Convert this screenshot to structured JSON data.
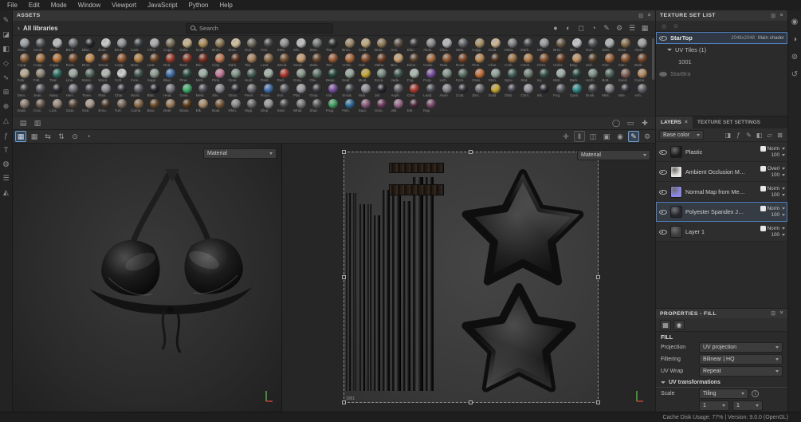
{
  "chrome": {
    "dock": "⊡",
    "close": "×"
  },
  "menubar": {
    "items": [
      "File",
      "Edit",
      "Mode",
      "Window",
      "Viewport",
      "JavaScript",
      "Python",
      "Help"
    ]
  },
  "tools": [
    {
      "name": "paint-tool-icon",
      "g": "✎"
    },
    {
      "name": "eraser-tool-icon",
      "g": "◪"
    },
    {
      "name": "projection-tool-icon",
      "g": "◧"
    },
    {
      "name": "polygon-fill-tool-icon",
      "g": "◇"
    },
    {
      "name": "smudge-tool-icon",
      "g": "∿"
    },
    {
      "name": "clone-tool-icon",
      "g": "⊞"
    },
    {
      "name": "material-picker-tool-icon",
      "g": "⊕"
    },
    {
      "name": "geometry-mask-tool-icon",
      "g": "△"
    },
    {
      "name": "effects-tool-icon",
      "g": "ƒ"
    },
    {
      "name": "text-tool-icon",
      "g": "T"
    },
    {
      "name": "particles-tool-icon",
      "g": "◍"
    },
    {
      "name": "shelf-tool-icon",
      "g": "☰"
    },
    {
      "name": "symmetry-tool-icon",
      "g": "◭"
    }
  ],
  "assets": {
    "panel_title": "ASSETS",
    "breadcrumb": "All libraries",
    "search_placeholder": "Search",
    "filter_icons": [
      {
        "name": "filter-materials-icon",
        "g": "●"
      },
      {
        "name": "filter-smart-materials-icon",
        "g": "◐"
      },
      {
        "name": "filter-smart-masks-icon",
        "g": "◻"
      },
      {
        "name": "filter-filters-icon",
        "g": "◔"
      },
      {
        "name": "filter-brushes-icon",
        "g": "✎"
      },
      {
        "name": "filter-settings-icon",
        "g": "⚙"
      },
      {
        "name": "list-view-icon",
        "g": "☰"
      },
      {
        "name": "grid-view-icon",
        "g": "▦"
      }
    ],
    "footer_left_icons": [
      {
        "name": "shelf-panel-icon",
        "g": "▤"
      },
      {
        "name": "import-resources-icon",
        "g": "▥"
      }
    ],
    "footer_right_icons": [
      {
        "name": "sphere-preview-icon",
        "g": "◯"
      },
      {
        "name": "plane-preview-icon",
        "g": "▭"
      },
      {
        "name": "add-resource-icon",
        "g": "✚"
      }
    ],
    "materials": [
      [
        "#9aa0a6",
        "Alum."
      ],
      [
        "#585b5e",
        "Anod."
      ],
      [
        "#b9bcc0",
        "Alum."
      ],
      [
        "#6f7377",
        "Bent."
      ],
      [
        "#26282a",
        "Blac."
      ],
      [
        "#caccce",
        "Bras."
      ],
      [
        "#8e9296",
        "Brus."
      ],
      [
        "#3f4346",
        "Cast."
      ],
      [
        "#a7a9ac",
        "Chro."
      ],
      [
        "#7c6f5a",
        "Copp."
      ],
      [
        "#c8b288",
        "Gold."
      ],
      [
        "#b08d57",
        "Gold."
      ],
      [
        "#8c7853",
        "Bron."
      ],
      [
        "#d4c29a",
        "Bras."
      ],
      [
        "#6e6a5e",
        "Gun."
      ],
      [
        "#4a4a4a",
        "Iron."
      ],
      [
        "#909090",
        "Stee."
      ],
      [
        "#bfc1c3",
        "Silv."
      ],
      [
        "#757779",
        "Stee."
      ],
      [
        "#2f3133",
        "Tita."
      ],
      [
        "#a08968",
        "Bron."
      ],
      [
        "#c0a878",
        "Gold."
      ],
      [
        "#927c58",
        "Bras."
      ],
      [
        "#5c5347",
        "Iron."
      ],
      [
        "#3a3a3c",
        "Blac."
      ],
      [
        "#888a8c",
        "Alum."
      ],
      [
        "#b5b7b9",
        "Chro."
      ],
      [
        "#63666a",
        "Stee."
      ],
      [
        "#ad9166",
        "Copp."
      ],
      [
        "#cdb68e",
        "Gold."
      ],
      [
        "#7e8184",
        "Meta."
      ],
      [
        "#46494c",
        "Dark."
      ],
      [
        "#979a9d",
        "Silv."
      ],
      [
        "#6b5d45",
        "Brnz."
      ],
      [
        "#c4c6c8",
        "Mirr."
      ],
      [
        "#53565a",
        "Gun."
      ],
      [
        "#aeb0b2",
        "Stee."
      ],
      [
        "#8a6f4d",
        "Bras."
      ],
      [
        "#9c9ea0",
        "Alum."
      ],
      [
        "#8a5a33",
        "Copp."
      ],
      [
        "#a9713f",
        "Copp."
      ],
      [
        "#b87333",
        "Copp."
      ],
      [
        "#7a4a28",
        "Rust."
      ],
      [
        "#c98a4b",
        "Bron."
      ],
      [
        "#5f3a22",
        "Wood."
      ],
      [
        "#96572e",
        "Copp."
      ],
      [
        "#b5803f",
        "Bras."
      ],
      [
        "#6d4326",
        "Leat."
      ],
      [
        "#a33c2e",
        "Red."
      ],
      [
        "#8f3a2a",
        "Rust."
      ],
      [
        "#7e2f24",
        "Bric."
      ],
      [
        "#c47a52",
        "Clay."
      ],
      [
        "#5a3020",
        "Dark."
      ],
      [
        "#a9845d",
        "Tan."
      ],
      [
        "#8b6a46",
        "Leat."
      ],
      [
        "#744f30",
        "Wood."
      ],
      [
        "#c79a6b",
        "Sand."
      ],
      [
        "#63452c",
        "Waln."
      ],
      [
        "#9d5c35",
        "Terr."
      ],
      [
        "#b06a3a",
        "Ambr."
      ],
      [
        "#854d2a",
        "Oak."
      ],
      [
        "#6f3d23",
        "Maho."
      ],
      [
        "#caa06e",
        "Birc."
      ],
      [
        "#58422c",
        "Ebon."
      ],
      [
        "#a76b3e",
        "Ceda."
      ],
      [
        "#905832",
        "Teak."
      ],
      [
        "#7c4626",
        "Rose."
      ],
      [
        "#bd8a55",
        "Pine."
      ],
      [
        "#4f3521",
        "Char."
      ],
      [
        "#9e7142",
        "Cork."
      ],
      [
        "#b27c45",
        "Hone."
      ],
      [
        "#87552f",
        "Ches."
      ],
      [
        "#6a3e24",
        "Umbr."
      ],
      [
        "#c09363",
        "Beig."
      ],
      [
        "#564028",
        "Soil."
      ],
      [
        "#a2653a",
        "Ginr."
      ],
      [
        "#8e5630",
        "Sien."
      ],
      [
        "#78482a",
        "Bark."
      ],
      [
        "#b8a88e",
        "Fabr."
      ],
      [
        "#8e8474",
        "Felt."
      ],
      [
        "#2e6e62",
        "Teal."
      ],
      [
        "#9aa89e",
        "Line."
      ],
      [
        "#556b60",
        "Moss."
      ],
      [
        "#b0b8ae",
        "Wool."
      ],
      [
        "#cfd2cf",
        "Cott."
      ],
      [
        "#41584e",
        "Fore."
      ],
      [
        "#8a9a8e",
        "Sage."
      ],
      [
        "#3f6fae",
        "Blue."
      ],
      [
        "#2f4f45",
        "Pine."
      ],
      [
        "#9eb0a4",
        "Mint."
      ],
      [
        "#c87a9a",
        "Pink."
      ],
      [
        "#7e9486",
        "Gree."
      ],
      [
        "#486056",
        "Hunt."
      ],
      [
        "#a4b4a8",
        "Past."
      ],
      [
        "#b03a2e",
        "Red."
      ],
      [
        "#88988c",
        "Gray."
      ],
      [
        "#60746a",
        "Oliv."
      ],
      [
        "#294a40",
        "Deep."
      ],
      [
        "#96a89c",
        "Seaf."
      ],
      [
        "#c8a832",
        "Must."
      ],
      [
        "#788c80",
        "Euca."
      ],
      [
        "#3e5a50",
        "Jade."
      ],
      [
        "#aab8ae",
        "Fog."
      ],
      [
        "#7a4fa0",
        "Purp."
      ],
      [
        "#82968a",
        "Lich."
      ],
      [
        "#5a7066",
        "Fern."
      ],
      [
        "#c87137",
        "Oran."
      ],
      [
        "#90a296",
        "Ston."
      ],
      [
        "#46625a",
        "Spru."
      ],
      [
        "#748478",
        "Slat."
      ],
      [
        "#38564c",
        "Ivy."
      ],
      [
        "#a0b0a6",
        "Mist."
      ],
      [
        "#2a4a42",
        "Dark."
      ],
      [
        "#7c9084",
        "Herb."
      ],
      [
        "#52685e",
        "Bott."
      ],
      [
        "#86655a",
        "Sued."
      ],
      [
        "#b5895f",
        "Came."
      ],
      [
        "#3b3b3d",
        "Deni."
      ],
      [
        "#54565c",
        "Jean."
      ],
      [
        "#2b2d33",
        "Navy."
      ],
      [
        "#6e7076",
        "Herr."
      ],
      [
        "#44464c",
        "Twee."
      ],
      [
        "#8a8c92",
        "Flan."
      ],
      [
        "#33353b",
        "Char."
      ],
      [
        "#5c5e64",
        "Wors."
      ],
      [
        "#24262c",
        "Blac."
      ],
      [
        "#76787e",
        "Heat."
      ],
      [
        "#3fae6a",
        "Gree."
      ],
      [
        "#4c4e54",
        "Mela."
      ],
      [
        "#86888e",
        "Silv."
      ],
      [
        "#2e3036",
        "Onyx."
      ],
      [
        "#66686e",
        "Pewt."
      ],
      [
        "#3f6fae",
        "Roya."
      ],
      [
        "#585a60",
        "Iron."
      ],
      [
        "#9b9da3",
        "Plat."
      ],
      [
        "#3a3c42",
        "Grap."
      ],
      [
        "#7a4fa0",
        "Viol."
      ],
      [
        "#44464c",
        "Smok."
      ],
      [
        "#8e9096",
        "Nick."
      ],
      [
        "#26282e",
        "Jet."
      ],
      [
        "#5e6066",
        "Asph."
      ],
      [
        "#b03a2e",
        "Crim."
      ],
      [
        "#4a4c52",
        "Lead."
      ],
      [
        "#82848a",
        "Alum."
      ],
      [
        "#303238",
        "Coal."
      ],
      [
        "#6a6c72",
        "Zinc."
      ],
      [
        "#c8a832",
        "Gold."
      ],
      [
        "#3e4046",
        "Obsi."
      ],
      [
        "#90929a",
        "Chro."
      ],
      [
        "#2a2c32",
        "Ink."
      ],
      [
        "#56585e",
        "Fog."
      ],
      [
        "#2e8b8b",
        "Cyan."
      ],
      [
        "#46484e",
        "Dusk."
      ],
      [
        "#7e8086",
        "Mist."
      ],
      [
        "#35373d",
        "Nite."
      ],
      [
        "#62646a",
        "Ash."
      ],
      [
        "#8a7a6a",
        "Snak."
      ],
      [
        "#6a5a4a",
        "Croc."
      ],
      [
        "#9a8a7a",
        "Liza."
      ],
      [
        "#5a4a3a",
        "Gato."
      ],
      [
        "#aa9a8a",
        "Ostr."
      ],
      [
        "#4a3a2a",
        "Emu."
      ],
      [
        "#7a6a5a",
        "Turt."
      ],
      [
        "#8a6a4a",
        "Came."
      ],
      [
        "#6a4a2a",
        "Biso."
      ],
      [
        "#9a7a5a",
        "Deer."
      ],
      [
        "#5a3a1a",
        "Moos."
      ],
      [
        "#aa8a6a",
        "Elk."
      ],
      [
        "#7a5a3a",
        "Boar."
      ],
      [
        "#8a8a8a",
        "Rhin."
      ],
      [
        "#6a6a6a",
        "Hipp."
      ],
      [
        "#9a9a9a",
        "Elep."
      ],
      [
        "#4a4a4a",
        "Seal."
      ],
      [
        "#7a7a7a",
        "Whal."
      ],
      [
        "#5a5a5a",
        "Shar."
      ],
      [
        "#3f9e5f",
        "Frog."
      ],
      [
        "#2e6e9e",
        "Fish."
      ],
      [
        "#8a5a7a",
        "Squi."
      ],
      [
        "#6a3a5a",
        "Octo."
      ],
      [
        "#9a6a8a",
        "Jell."
      ],
      [
        "#4a2a3a",
        "Eel."
      ],
      [
        "#7a4a6a",
        "Ray."
      ]
    ]
  },
  "vp_toolbar": {
    "left_icons": [
      {
        "name": "snap-grid-icon",
        "g": "▦",
        "active": true
      },
      {
        "name": "grid-icon",
        "g": "▦"
      },
      {
        "name": "symmetry-icon",
        "g": "⇆"
      },
      {
        "name": "mirror-icon",
        "g": "⇅"
      },
      {
        "name": "lazy-mouse-icon",
        "g": "⊙"
      },
      {
        "name": "history-icon",
        "g": "◔"
      }
    ],
    "right_icons": [
      {
        "name": "transform-gizmo-icon",
        "g": "✛"
      },
      {
        "name": "pause-engine-icon",
        "g": "Ⅱ",
        "boxed": true
      },
      {
        "name": "compare-view-icon",
        "g": "◫"
      },
      {
        "name": "camera-icon",
        "g": "▣"
      },
      {
        "name": "screenshot-icon",
        "g": "◉"
      },
      {
        "name": "pencil-mode-icon",
        "g": "✎",
        "active": true
      },
      {
        "name": "viewport-settings-icon",
        "g": "⚙"
      }
    ]
  },
  "viewport": {
    "left_material_label": "Material",
    "right_material_label": "Material",
    "tile_label": "1001"
  },
  "right_rail_icons": [
    {
      "name": "display-settings-icon",
      "g": "◉"
    },
    {
      "name": "shader-settings-icon",
      "g": "◑"
    },
    {
      "name": "camera-settings-icon",
      "g": "⊚"
    },
    {
      "name": "history-panel-icon",
      "g": "↺"
    }
  ],
  "texture_set_list": {
    "title": "TEXTURE SET LIST",
    "toolbar_icons": [
      {
        "name": "tsl-filter-icon",
        "g": "◎"
      },
      {
        "name": "tsl-search-icon",
        "g": "⊙"
      }
    ],
    "rows": {
      "main": {
        "name": "StarTop",
        "size": "2048x2048",
        "shader": "Main shader"
      },
      "uv_tiles": "UV Tiles (1)",
      "tile": "1001",
      "other": "StarBra"
    }
  },
  "layers": {
    "tab_layers": "LAYERS",
    "tab_settings": "TEXTURE SET SETTINGS",
    "channel": "Base color",
    "toolbar_icons": [
      {
        "name": "add-mask-icon",
        "g": "◨"
      },
      {
        "name": "add-effect-icon",
        "g": "ƒ"
      },
      {
        "name": "add-paint-layer-icon",
        "g": "✎"
      },
      {
        "name": "add-fill-layer-icon",
        "g": "◧"
      },
      {
        "name": "add-folder-icon",
        "g": "▱"
      },
      {
        "name": "delete-layer-icon",
        "g": "⊠"
      }
    ],
    "rows": [
      {
        "name": "Plastic",
        "blend": "Norm",
        "opacity": "100",
        "thumb": "#1b1b1e",
        "selected": false
      },
      {
        "name": "Ambient Occlusion Map from Mesh ...",
        "blend": "Overl",
        "opacity": "100",
        "thumb": "#e6e4e0",
        "selected": false
      },
      {
        "name": "Normal Map from Mesh StarBra",
        "blend": "Norm",
        "opacity": "100",
        "thumb": "#8b87e8",
        "selected": false
      },
      {
        "name": "Polyester Spandex Jersey",
        "blend": "Norm",
        "opacity": "100",
        "thumb": "#26262c",
        "selected": true
      },
      {
        "name": "Layer 1",
        "blend": "Norm",
        "opacity": "100",
        "thumb": "#3b3b3b",
        "selected": false
      }
    ]
  },
  "properties": {
    "title": "PROPERTIES - FILL",
    "mode_icons": [
      {
        "name": "material-mode-icon",
        "g": "▦"
      },
      {
        "name": "sphere-mode-icon",
        "g": "◉"
      }
    ],
    "section": "FILL",
    "fields": [
      {
        "label": "Projection",
        "value": "UV projection"
      },
      {
        "label": "Filtering",
        "value": "Bilinear | HQ"
      },
      {
        "label": "UV Wrap",
        "value": "Repeat"
      }
    ],
    "transform_section": "UV transformations",
    "scale_label": "Scale",
    "scale_mode": "Tiling",
    "scale_x": "1",
    "scale_y": "1"
  },
  "statusbar": {
    "text": "Cache Disk Usage:  77% | Version: 9.0.0 (OpenGL)"
  }
}
